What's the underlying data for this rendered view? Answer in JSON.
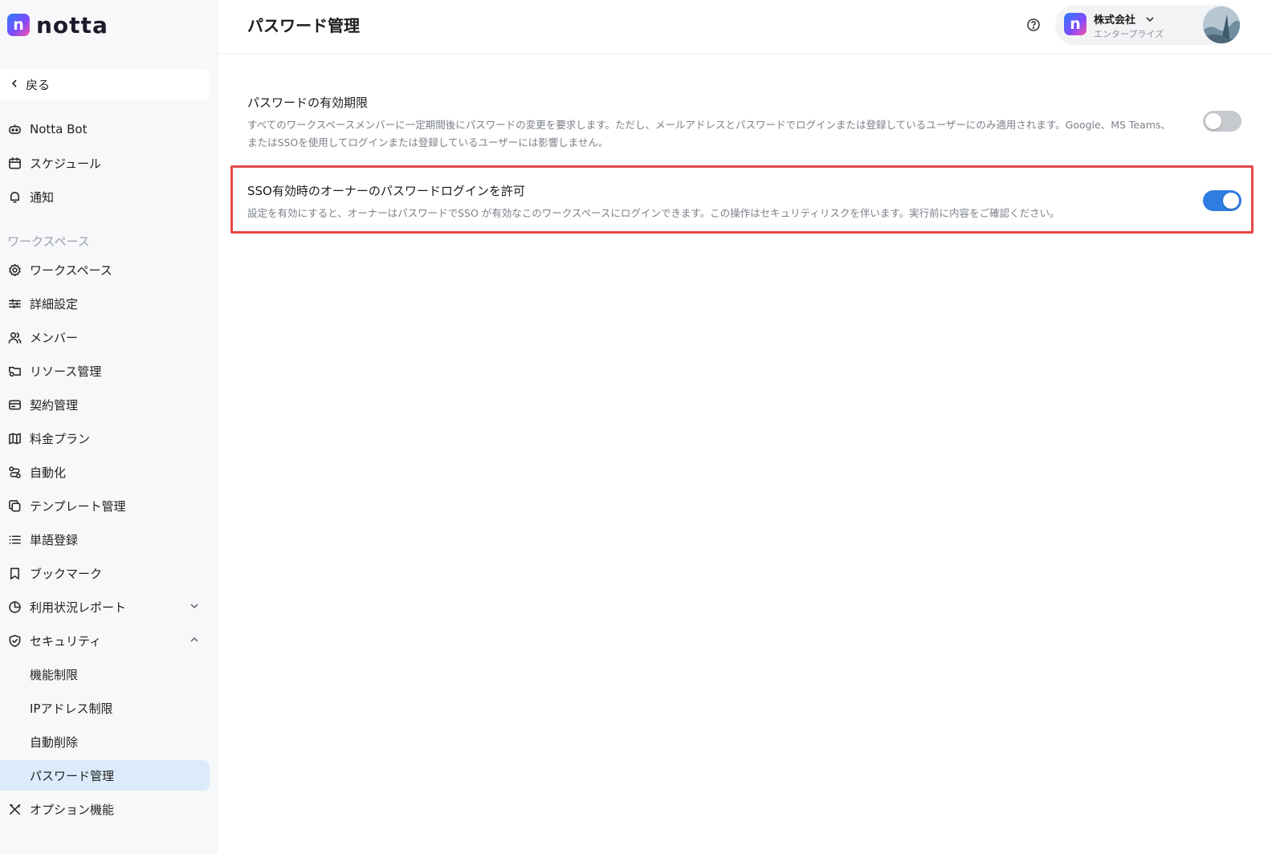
{
  "brand": {
    "name": "notta",
    "mark": "n"
  },
  "sidebar": {
    "back_label": "戻る",
    "top_items": [
      {
        "label": "Notta Bot",
        "icon": "bot-icon"
      },
      {
        "label": "スケジュール",
        "icon": "calendar-icon"
      },
      {
        "label": "通知",
        "icon": "bell-icon"
      }
    ],
    "section_label": "ワークスペース",
    "workspace_items": [
      {
        "label": "ワークスペース",
        "icon": "gear-icon"
      },
      {
        "label": "詳細設定",
        "icon": "sliders-icon"
      },
      {
        "label": "メンバー",
        "icon": "users-icon"
      },
      {
        "label": "リソース管理",
        "icon": "folder-gear-icon"
      },
      {
        "label": "契約管理",
        "icon": "card-icon"
      },
      {
        "label": "料金プラン",
        "icon": "map-icon"
      },
      {
        "label": "自動化",
        "icon": "automation-icon"
      },
      {
        "label": "テンプレート管理",
        "icon": "template-icon"
      },
      {
        "label": "単語登録",
        "icon": "list-icon"
      },
      {
        "label": "ブックマーク",
        "icon": "bookmark-icon"
      },
      {
        "label": "利用状況レポート",
        "icon": "pie-chart-icon"
      },
      {
        "label": "セキュリティ",
        "icon": "shield-icon"
      }
    ],
    "security_sub_items": [
      {
        "label": "機能制限"
      },
      {
        "label": "IPアドレス制限"
      },
      {
        "label": "自動削除"
      },
      {
        "label": "パスワード管理",
        "active": true
      }
    ],
    "bottom_items": [
      {
        "label": "オプション機能",
        "icon": "tools-icon"
      }
    ]
  },
  "header": {
    "title": "パスワード管理",
    "org": {
      "name": "株式会社",
      "plan": "エンタープライズ"
    }
  },
  "settings": [
    {
      "title": "パスワードの有効期限",
      "description": "すべてのワークスペースメンバーに一定期間後にパスワードの変更を要求します。ただし、メールアドレスとパスワードでログインまたは登録しているユーザーにのみ適用されます。Google、MS Teams、またはSSOを使用してログインまたは登録しているユーザーには影響しません。",
      "enabled": false
    },
    {
      "title": "SSO有効時のオーナーのパスワードログインを許可",
      "description": "設定を有効にすると、オーナーはパスワードでSSO が有効なこのワークスペースにログインできます。この操作はセキュリティリスクを伴います。実行前に内容をご確認ください。",
      "enabled": true,
      "highlighted": true
    }
  ],
  "colors": {
    "accent": "#2f7de1",
    "active_bg": "#dcebfb",
    "highlight": "#e54848"
  }
}
